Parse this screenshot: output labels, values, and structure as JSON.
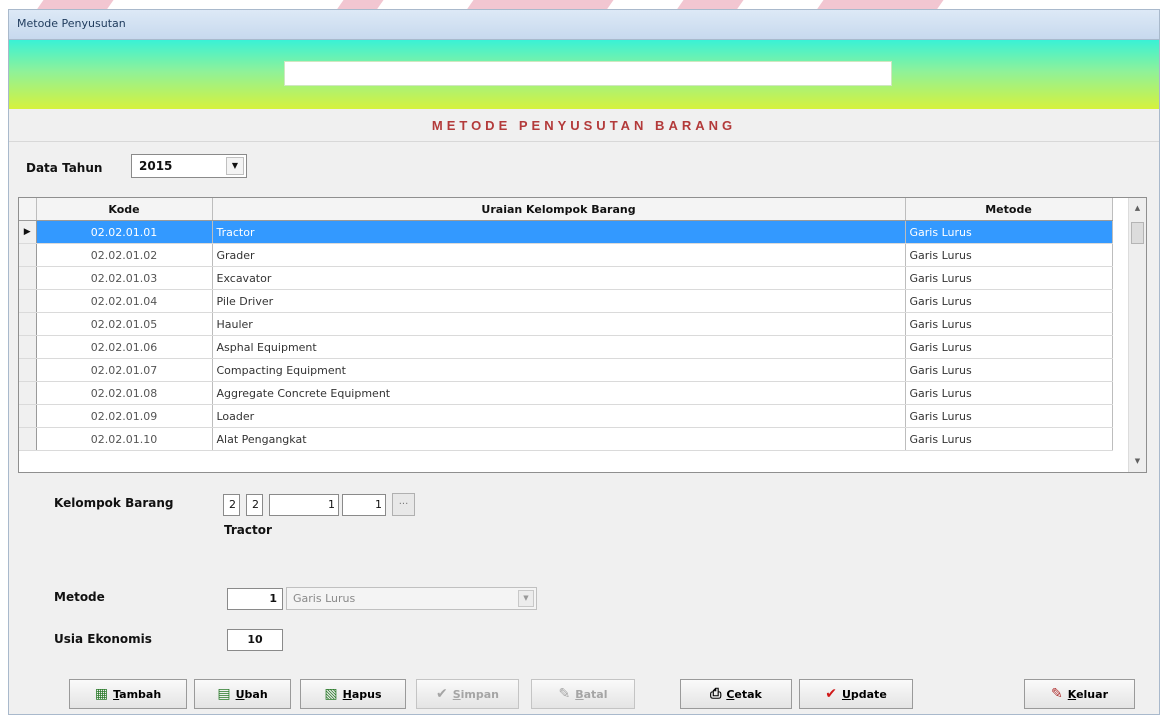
{
  "window": {
    "title": "Metode Penyusutan"
  },
  "heading": "METODE PENYUSUTAN BARANG",
  "filter": {
    "year_label": "Data Tahun",
    "year_value": "2015"
  },
  "table": {
    "columns": [
      "Kode",
      "Uraian Kelompok Barang",
      "Metode"
    ],
    "rows": [
      {
        "kode": "02.02.01.01",
        "uraian": "Tractor",
        "metode": "Garis Lurus"
      },
      {
        "kode": "02.02.01.02",
        "uraian": "Grader",
        "metode": "Garis Lurus"
      },
      {
        "kode": "02.02.01.03",
        "uraian": "Excavator",
        "metode": "Garis Lurus"
      },
      {
        "kode": "02.02.01.04",
        "uraian": "Pile Driver",
        "metode": "Garis Lurus"
      },
      {
        "kode": "02.02.01.05",
        "uraian": "Hauler",
        "metode": "Garis Lurus"
      },
      {
        "kode": "02.02.01.06",
        "uraian": "Asphal Equipment",
        "metode": "Garis Lurus"
      },
      {
        "kode": "02.02.01.07",
        "uraian": "Compacting Equipment",
        "metode": "Garis Lurus"
      },
      {
        "kode": "02.02.01.08",
        "uraian": "Aggregate Concrete Equipment",
        "metode": "Garis Lurus"
      },
      {
        "kode": "02.02.01.09",
        "uraian": "Loader",
        "metode": "Garis Lurus"
      },
      {
        "kode": "02.02.01.10",
        "uraian": "Alat Pengangkat",
        "metode": "Garis Lurus"
      }
    ]
  },
  "form": {
    "kelompok_label": "Kelompok Barang",
    "kelompok_codes": [
      "2",
      "2",
      "1",
      "1"
    ],
    "kelompok_name": "Tractor",
    "metode_label": "Metode",
    "metode_code": "1",
    "metode_value": "Garis Lurus",
    "usia_label": "Usia Ekonomis",
    "usia_value": "10"
  },
  "buttons": {
    "tambah": {
      "key": "T",
      "rest": "ambah"
    },
    "ubah": {
      "key": "U",
      "rest": "bah"
    },
    "hapus": {
      "key": "H",
      "rest": "apus"
    },
    "simpan": {
      "key": "S",
      "rest": "impan"
    },
    "batal": {
      "key": "B",
      "rest": "atal"
    },
    "cetak": {
      "key": "C",
      "rest": "etak"
    },
    "update": {
      "key": "U",
      "rest": "pdate"
    },
    "keluar": {
      "key": "K",
      "rest": "eluar"
    }
  }
}
